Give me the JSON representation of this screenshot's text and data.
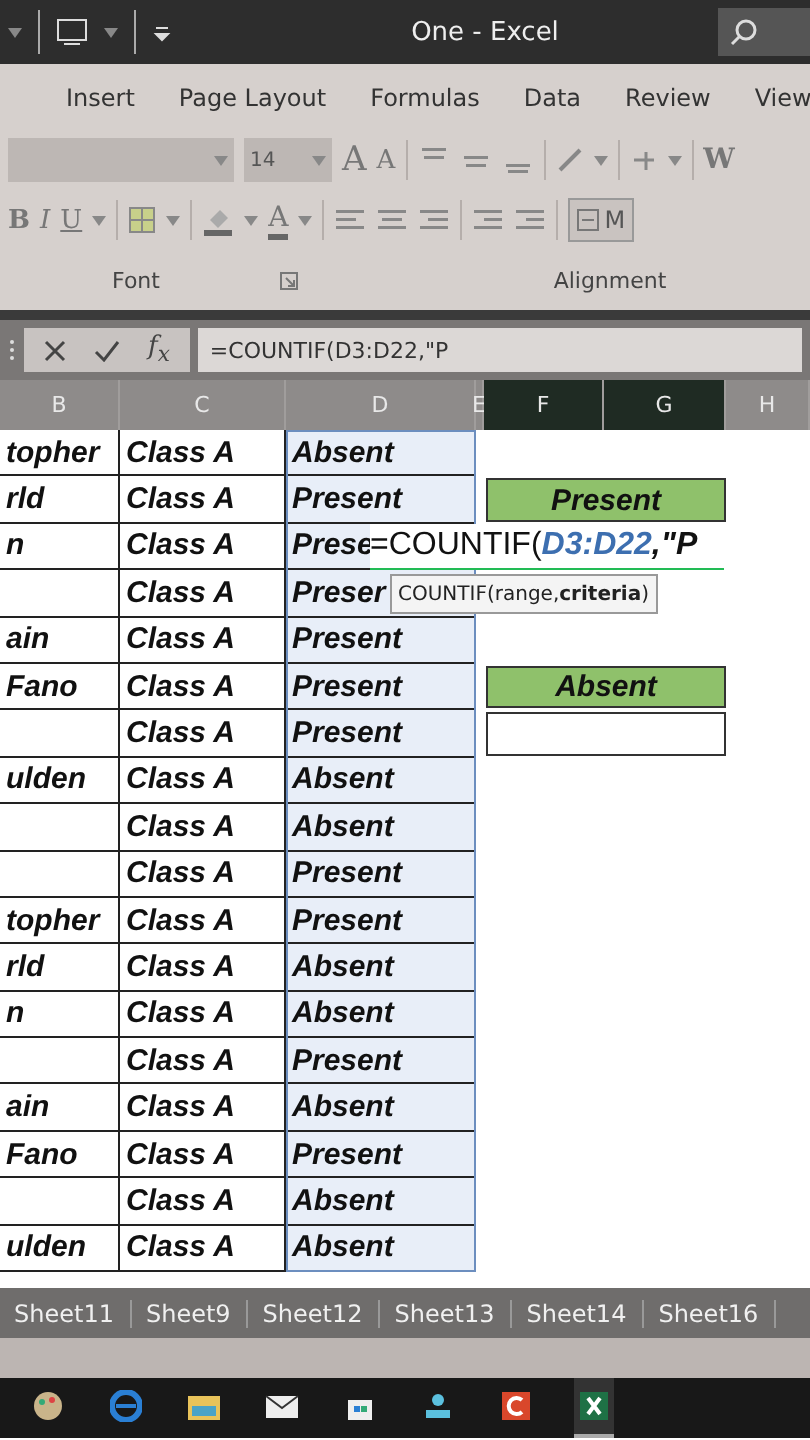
{
  "window": {
    "title": "One - Excel"
  },
  "ribbon_tabs": [
    {
      "label": "Insert",
      "selected": false
    },
    {
      "label": "Page Layout",
      "selected": false
    },
    {
      "label": "Formulas",
      "selected": false
    },
    {
      "label": "Data",
      "selected": false
    },
    {
      "label": "Review",
      "selected": false
    },
    {
      "label": "View",
      "selected": false
    }
  ],
  "ribbon": {
    "font_size": "14",
    "grow_font": "A",
    "shrink_font": "A",
    "wrap_text": "W",
    "bold": "B",
    "italic": "I",
    "underline": "U",
    "font_color": "A",
    "merge": "M",
    "groups": [
      {
        "label": "Font",
        "launcher": true
      },
      {
        "label": "Alignment",
        "launcher": false
      }
    ]
  },
  "formula_bar": {
    "function_label": "f$_{x}$",
    "formula": "=COUNTIF(D3:D22,\"P"
  },
  "columns": [
    {
      "label": "B",
      "selected": false,
      "range_highlight": false
    },
    {
      "label": "C",
      "selected": false,
      "range_highlight": false
    },
    {
      "label": "D",
      "selected": false,
      "range_highlight": true
    },
    {
      "label": "E",
      "selected": false
    },
    {
      "label": "F",
      "selected": true
    },
    {
      "label": "G",
      "selected": true
    },
    {
      "label": "H",
      "selected": false
    }
  ],
  "rows": [
    {
      "b": "topher",
      "c": "Class A",
      "d": "Absent"
    },
    {
      "b": "rld",
      "c": "Class A",
      "d": "Present",
      "summary": {
        "kind": "header",
        "text": "Present"
      }
    },
    {
      "b": "n",
      "c": "Class A",
      "d": "Prese",
      "cell_editor": [
        {
          "kind": "plain",
          "text": "=COUNTIF("
        },
        {
          "kind": "reference",
          "text": "D3:D22"
        },
        {
          "kind": "typed",
          "text": ",\"P"
        }
      ]
    },
    {
      "c": "Class A",
      "d": "Preser",
      "tooltip": [
        {
          "kind": "plain",
          "text": "COUNTIF(range, "
        },
        {
          "kind": "argument",
          "text": "criteria"
        },
        {
          "kind": "plain",
          "text": ")"
        }
      ]
    },
    {
      "b": "ain",
      "c": "Class A",
      "d": "Present"
    },
    {
      "b": "Fano",
      "c": "Class A",
      "d": "Present",
      "summary": {
        "kind": "header",
        "text": "Absent"
      }
    },
    {
      "c": "Class A",
      "d": "Present",
      "summary": {
        "kind": "blank"
      }
    },
    {
      "b": "ulden",
      "c": "Class A",
      "d": "Absent"
    },
    {
      "c": "Class A",
      "d": "Absent"
    },
    {
      "c": "Class A",
      "d": "Present"
    },
    {
      "b": "topher",
      "c": "Class A",
      "d": "Present"
    },
    {
      "b": "rld",
      "c": "Class A",
      "d": "Absent"
    },
    {
      "b": "n",
      "c": "Class A",
      "d": "Absent"
    },
    {
      "c": "Class A",
      "d": "Present"
    },
    {
      "b": "ain",
      "c": "Class A",
      "d": "Absent"
    },
    {
      "b": "Fano",
      "c": "Class A",
      "d": "Present"
    },
    {
      "c": "Class A",
      "d": "Absent"
    },
    {
      "b": "ulden",
      "c": "Class A",
      "d": "Absent"
    }
  ],
  "sheet_tabs": [
    {
      "label": "Sheet11",
      "selected": false
    },
    {
      "label": "Sheet9",
      "selected": false
    },
    {
      "label": "Sheet12",
      "selected": false
    },
    {
      "label": "Sheet13",
      "selected": false
    },
    {
      "label": "Sheet14",
      "selected": false
    },
    {
      "label": "Sheet16",
      "selected": false
    }
  ],
  "taskbar": [
    {
      "kind": "paint",
      "active": false
    },
    {
      "kind": "browser",
      "active": false
    },
    {
      "kind": "folder",
      "active": false
    },
    {
      "kind": "mail",
      "active": false
    },
    {
      "kind": "store",
      "active": false
    },
    {
      "kind": "remote",
      "active": false
    },
    {
      "kind": "red-app",
      "active": false
    },
    {
      "kind": "excel",
      "active": true
    }
  ]
}
